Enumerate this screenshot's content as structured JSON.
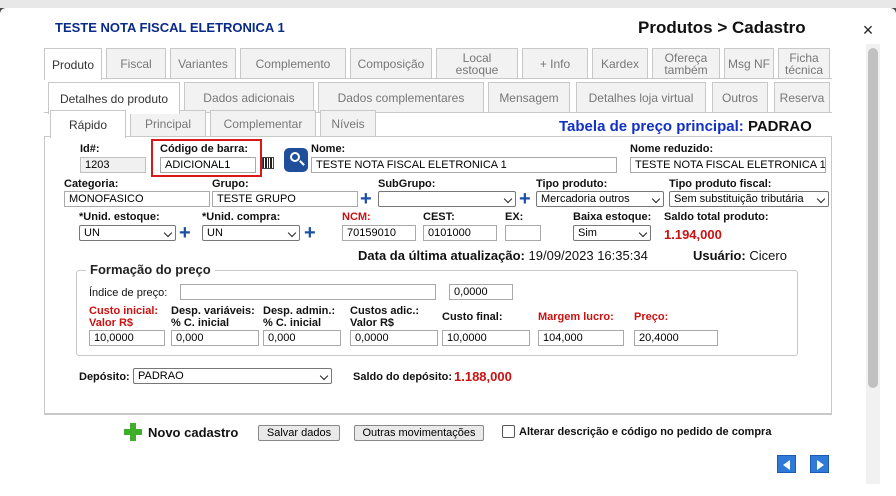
{
  "window": {
    "form_title": "TESTE NOTA FISCAL ELETRONICA 1",
    "breadcrumb": "Produtos > Cadastro",
    "close_glyph": "×"
  },
  "main_tabs": [
    "Produto",
    "Fiscal",
    "Variantes",
    "Complemento",
    "Composição",
    "Local estoque",
    "+ Info",
    "Kardex",
    "Ofereça também",
    "Msg NF",
    "Ficha técnica"
  ],
  "sub_tabs": [
    "Detalhes do produto",
    "Dados adicionais",
    "Dados complementares",
    "Mensagem",
    "Detalhes loja virtual",
    "Outros",
    "Reserva"
  ],
  "third_tabs": [
    "Rápido",
    "Principal",
    "Complementar",
    "Níveis"
  ],
  "price_table": {
    "label": "Tabela de preço principal:",
    "value": "PADRAO"
  },
  "fields": {
    "id_label": "Id#:",
    "id_value": "1203",
    "barcode_label": "Código de barra:",
    "barcode_value": "ADICIONAL1",
    "name_label": "Nome:",
    "name_value": "TESTE  NOTA FISCAL  ELETRONICA 1",
    "short_name_label": "Nome reduzido:",
    "short_name_value": "TESTE  NOTA FISCAL  ELETRONICA 1",
    "category_label": "Categoria:",
    "category_value": "MONOFASICO",
    "group_label": "Grupo:",
    "group_value": "TESTE GRUPO",
    "subgroup_label": "SubGrupo:",
    "subgroup_value": "",
    "product_type_label": "Tipo produto:",
    "product_type_value": "Mercadoria outros",
    "fiscal_type_label": "Tipo produto fiscal:",
    "fiscal_type_value": "Sem substituição tributária",
    "stock_unit_label": "*Unid. estoque:",
    "stock_unit_value": "UN",
    "purchase_unit_label": "*Unid. compra:",
    "purchase_unit_value": "UN",
    "ncm_label": "NCM:",
    "ncm_value": "70159010",
    "cest_label": "CEST:",
    "cest_value": "0101000",
    "ex_label": "EX:",
    "ex_value": "",
    "stock_drop_label": "Baixa estoque:",
    "stock_drop_value": "Sim",
    "total_balance_label": "Saldo total produto:",
    "total_balance_value": "1.194,000"
  },
  "update_info": {
    "date_label": "Data da última atualização:",
    "date_value": "19/09/2023 16:35:34",
    "user_label": "Usuário:",
    "user_value": "Cicero"
  },
  "pricing": {
    "legend": "Formação do preço",
    "index_label": "Índice de preço:",
    "index_value": "",
    "index_result": "0,0000",
    "col_labels": [
      "Custo inicial:\nValor R$",
      "Desp. variáveis:\n% C. inicial",
      "Desp. admin.:\n% C. inicial",
      "Custos adic.:\nValor R$",
      "Custo final:",
      "Margem lucro:",
      "Preço:"
    ],
    "values": [
      "10,0000",
      "0,000",
      "0,000",
      "0,0000",
      "10,0000",
      "104,000",
      "20,4000"
    ]
  },
  "deposit": {
    "label": "Depósito:",
    "value": "PADRAO",
    "balance_label": "Saldo do depósito:",
    "balance_value": "1.188,000"
  },
  "footer": {
    "new_label": "Novo cadastro",
    "save_label": "Salvar dados",
    "other_label": "Outras movimentações",
    "checkbox_label": "Alterar descrição e código no pedido de compra"
  },
  "colors": {
    "title_blue": "#0a2a8a",
    "accent_red": "#cc1111",
    "price_blue": "#1330c4",
    "nav_blue": "#2f7ad6",
    "green": "#3fae2a"
  }
}
